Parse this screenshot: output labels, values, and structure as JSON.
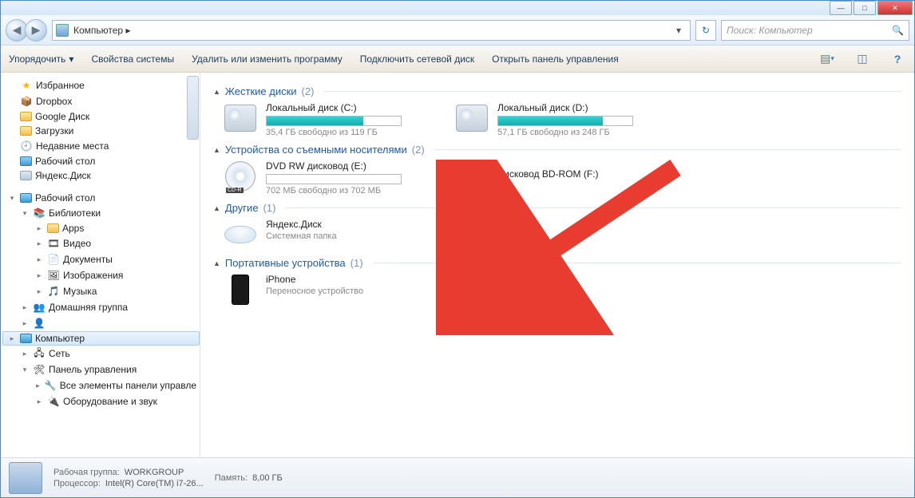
{
  "titlebar": {
    "min": "—",
    "max": "□",
    "close": "✕"
  },
  "nav": {
    "back": "◀",
    "forward": "▶",
    "breadcrumb": "Компьютер  ▸",
    "dropdown": "▾",
    "refresh": "↻",
    "search_placeholder": "Поиск: Компьютер"
  },
  "toolbar": {
    "organize": "Упорядочить",
    "organize_drop": "▾",
    "props": "Свойства системы",
    "uninstall": "Удалить или изменить программу",
    "map_drive": "Подключить сетевой диск",
    "control_panel": "Открыть панель управления",
    "view_drop": "▾",
    "help": "?"
  },
  "sidebar": {
    "favorites": "Избранное",
    "fav_items": [
      "Dropbox",
      "Google Диск",
      "Загрузки",
      "Недавние места",
      "Рабочий стол",
      "Яндекс.Диск"
    ],
    "desktop": "Рабочий стол",
    "libraries": "Библиотеки",
    "lib_items": [
      "Apps",
      "Видео",
      "Документы",
      "Изображения",
      "Музыка"
    ],
    "homegroup": "Домашняя группа",
    "user_hidden": "",
    "computer": "Компьютер",
    "network": "Сеть",
    "cpanel": "Панель управления",
    "cpanel_items": [
      "Все элементы панели управле",
      "Оборудование и звук"
    ]
  },
  "groups": {
    "hdd": {
      "title": "Жесткие диски",
      "count": "(2)"
    },
    "removable": {
      "title": "Устройства со съемными носителями",
      "count": "(2)"
    },
    "other": {
      "title": "Другие",
      "count": "(1)"
    },
    "portable": {
      "title": "Портативные устройства",
      "count": "(1)"
    }
  },
  "drives": {
    "c": {
      "name": "Локальный диск (C:)",
      "sub": "35,4 ГБ свободно из 119 ГБ",
      "fill": 72
    },
    "d": {
      "name": "Локальный диск (D:)",
      "sub": "57,1 ГБ свободно из 248 ГБ",
      "fill": 78
    },
    "e": {
      "name": "DVD RW дисковод (E:)",
      "sub": "702 МБ свободно из 702 МБ",
      "fill": 0
    },
    "f": {
      "name": "Дисковод BD-ROM (F:)",
      "sub": ""
    },
    "yd": {
      "name": "Яндекс.Диск",
      "sub": "Системная папка"
    },
    "iphone": {
      "name": "iPhone",
      "sub": "Переносное устройство"
    }
  },
  "status": {
    "workgroup_lbl": "Рабочая группа:",
    "workgroup": "WORKGROUP",
    "cpu_lbl": "Процессор:",
    "cpu": "Intel(R) Core(TM) i7-26...",
    "mem_lbl": "Память:",
    "mem": "8,00 ГБ"
  }
}
